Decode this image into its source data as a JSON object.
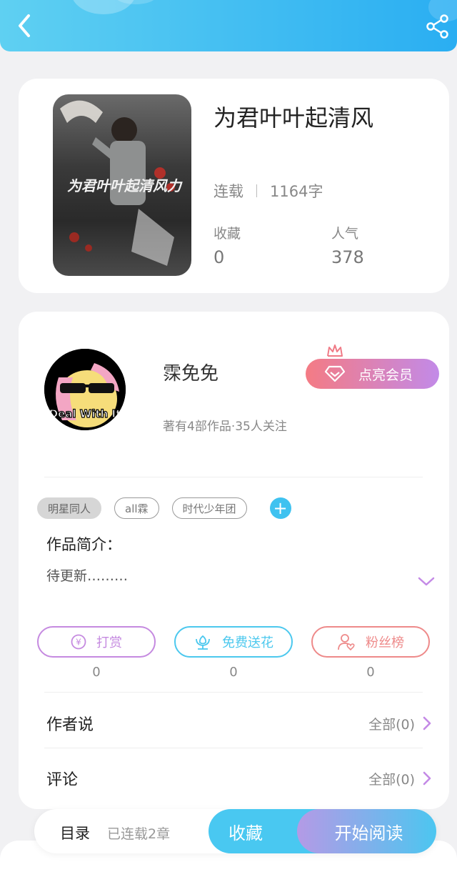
{
  "header": {
    "back_icon": "chevron-left-icon",
    "share_icon": "share-icon"
  },
  "book": {
    "title": "为君叶叶起清风",
    "status": "连载",
    "word_count": "1164字",
    "favorites_label": "收藏",
    "favorites_value": "0",
    "popularity_label": "人气",
    "popularity_value": "378",
    "cover_text": "为君叶叶起清风力"
  },
  "author": {
    "name": "霂免免",
    "meta": "著有4部作品·35人关注",
    "vip_label": "点亮会员",
    "avatar_caption": "Deal With It"
  },
  "tags": [
    "明星同人",
    "all霖",
    "时代少年团"
  ],
  "intro": {
    "label": "作品简介：",
    "text": "待更新………"
  },
  "actions": [
    {
      "label": "打赏",
      "count": "0",
      "color": "#c58ae0"
    },
    {
      "label": "免费送花",
      "count": "0",
      "color": "#4cc8ee"
    },
    {
      "label": "粉丝榜",
      "count": "0",
      "color": "#ee8a8a"
    }
  ],
  "sections": {
    "author_says": {
      "label": "作者说",
      "more": "全部(0)"
    },
    "comments": {
      "label": "评论",
      "more": "全部(0)"
    }
  },
  "bottom": {
    "toc_label": "目录",
    "toc_sub": "已连载2章",
    "collect_label": "收藏",
    "read_label": "开始阅读"
  }
}
